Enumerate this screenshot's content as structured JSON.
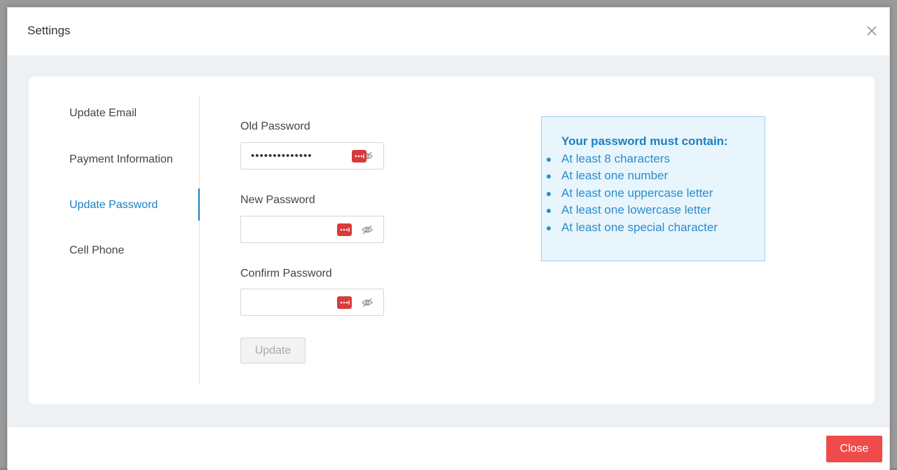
{
  "modal": {
    "title": "Settings"
  },
  "sidebar": {
    "items": [
      {
        "label": "Update Email",
        "active": false
      },
      {
        "label": "Payment Information",
        "active": false
      },
      {
        "label": "Update Password",
        "active": true
      },
      {
        "label": "Cell Phone",
        "active": false
      }
    ]
  },
  "form": {
    "old_password": {
      "label": "Old Password",
      "value": "••••••••••••••"
    },
    "new_password": {
      "label": "New Password",
      "value": ""
    },
    "confirm_password": {
      "label": "Confirm Password",
      "value": ""
    },
    "update_label": "Update"
  },
  "requirements": {
    "title": "Your password must contain:",
    "items": [
      "At least 8 characters",
      "At least one number",
      "At least one uppercase letter",
      "At least one lowercase letter",
      "At least one special character"
    ]
  },
  "footer": {
    "close_label": "Close"
  },
  "colors": {
    "accent": "#1a7fc1",
    "danger": "#ef4b4b",
    "info_bg": "#e8f5fc",
    "password_manager_icon": "#d93a3a"
  },
  "icons": {
    "close": "close-icon",
    "password_manager": "password-manager-icon",
    "visibility_toggle": "eye-slash-icon"
  }
}
